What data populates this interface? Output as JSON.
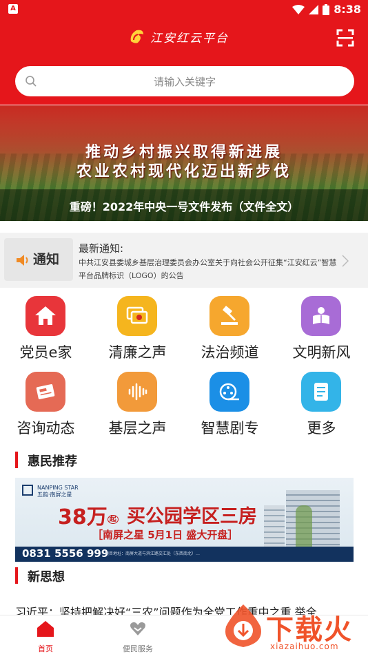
{
  "status_bar": {
    "time": "8:38",
    "left_badge": "A"
  },
  "header": {
    "app_title": "江安红云平台"
  },
  "search": {
    "placeholder": "请输入关键字"
  },
  "banner": {
    "line1": "推动乡村振兴取得新进展",
    "line2": "农业农村现代化迈出新步伐",
    "caption": "重磅！2022年中央一号文件发布（文件全文）"
  },
  "notice": {
    "badge": "通知",
    "title": "最新通知:",
    "text": "中共江安县委城乡基层治理委员会办公室关于向社会公开征集“江安红云”智慧平台品牌标识（LOGO）的公告"
  },
  "grid": [
    {
      "label": "党员e家",
      "icon": "home-icon",
      "color": "#e8353a"
    },
    {
      "label": "清廉之声",
      "icon": "chat-bubbles-icon",
      "color": "#f5b51e"
    },
    {
      "label": "法治频道",
      "icon": "gavel-icon",
      "color": "#f6a72e"
    },
    {
      "label": "文明新风",
      "icon": "reader-icon",
      "color": "#a86cd6"
    },
    {
      "label": "咨询动态",
      "icon": "newspaper-icon",
      "color": "#e56a55"
    },
    {
      "label": "基层之声",
      "icon": "soundwave-icon",
      "color": "#f29a3a"
    },
    {
      "label": "智慧剧专",
      "icon": "film-reel-icon",
      "color": "#1b8fe6"
    },
    {
      "label": "更多",
      "icon": "document-icon",
      "color": "#33b4e8"
    }
  ],
  "sections": {
    "recommend_title": "惠民推荐",
    "thought_title": "新思想"
  },
  "ad": {
    "logo": "NANPING STAR 五韵·南屏之星",
    "price": "38万",
    "price_suffix": "起",
    "slogan": "买公园学区三房",
    "sub": "［南屏之星 5月1日 盛大开盘］",
    "phone": "0831 5556 999",
    "footnote": "项目地址：南屏大道与滨江路交汇处（东西南北）…"
  },
  "news": {
    "headline": "习近平：坚持把解决好“三农”问题作为全党工作重中之重 举全"
  },
  "tabs": [
    {
      "label": "首页",
      "active": true
    },
    {
      "label": "便民服务",
      "active": false
    }
  ],
  "watermark": {
    "text": "下载火",
    "url": "xiazaihuo.com"
  }
}
